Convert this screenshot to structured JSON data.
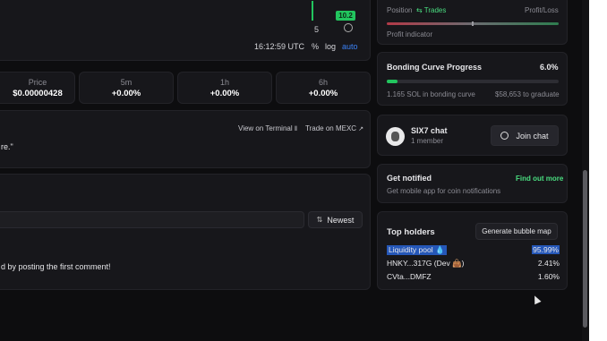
{
  "chart_top": {
    "candle_value": "10.2",
    "axis_tick": "5",
    "time": "16:12:59 UTC",
    "controls": [
      "%",
      "log",
      "auto"
    ],
    "accent": "#22c55e"
  },
  "stats": [
    {
      "label": "Price",
      "value": "$0.00000428"
    },
    {
      "label": "5m",
      "value": "+0.00%"
    },
    {
      "label": "1h",
      "value": "+0.00%"
    },
    {
      "label": "6h",
      "value": "+0.00%"
    }
  ],
  "info_card": {
    "terminal_link": "View on Terminal",
    "mexc_link": "Trade on MEXC",
    "quote_fragment": "re.\""
  },
  "comments": {
    "sort_label": "Newest",
    "empty_text": "d by posting the first comment!"
  },
  "position": {
    "position_label": "Position",
    "trades_label": "Trades",
    "profit_loss_label": "Profit/Loss",
    "indicator_label": "Profit indicator"
  },
  "bonding": {
    "title": "Bonding Curve Progress",
    "percent": "6.0%",
    "progress": 0.06,
    "sol_text": "1.165 SOL in bonding curve",
    "graduate_text": "$58,653 to graduate"
  },
  "chat": {
    "name": "SIX7 chat",
    "members": "1 member",
    "join_label": "Join chat"
  },
  "notify": {
    "title": "Get notified",
    "subtitle": "Get mobile app for coin notifications",
    "link": "Find out more"
  },
  "holders": {
    "title": "Top holders",
    "bubble_button": "Generate bubble map",
    "rows": [
      {
        "name": "Liquidity pool 💧",
        "pct": "95.99%"
      },
      {
        "name": "HNKY...317G (Dev 👜)",
        "pct": "2.41%"
      },
      {
        "name": "CVta...DMFZ",
        "pct": "1.60%"
      }
    ]
  }
}
